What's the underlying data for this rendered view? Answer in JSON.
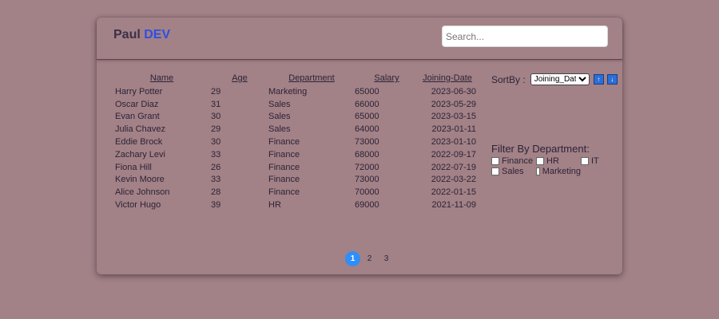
{
  "header": {
    "brand_first": "Paul",
    "brand_second": "DEV",
    "search_placeholder": "Search..."
  },
  "table": {
    "columns": [
      "Name",
      "Age",
      "Department",
      "Salary",
      "Joining-Date"
    ],
    "rows": [
      [
        "Harry Potter",
        "29",
        "Marketing",
        "65000",
        "2023-06-30"
      ],
      [
        "Oscar Diaz",
        "31",
        "Sales",
        "66000",
        "2023-05-29"
      ],
      [
        "Evan Grant",
        "30",
        "Sales",
        "65000",
        "2023-03-15"
      ],
      [
        "Julia Chavez",
        "29",
        "Sales",
        "64000",
        "2023-01-11"
      ],
      [
        "Eddie Brock",
        "30",
        "Finance",
        "73000",
        "2023-01-10"
      ],
      [
        "Zachary Levi",
        "33",
        "Finance",
        "68000",
        "2022-09-17"
      ],
      [
        "Fiona Hill",
        "26",
        "Finance",
        "72000",
        "2022-07-19"
      ],
      [
        "Kevin Moore",
        "33",
        "Finance",
        "73000",
        "2022-03-22"
      ],
      [
        "Alice Johnson",
        "28",
        "Finance",
        "70000",
        "2022-01-15"
      ],
      [
        "Victor Hugo",
        "39",
        "HR",
        "69000",
        "2021-11-09"
      ]
    ]
  },
  "sort": {
    "label": "SortBy :",
    "selected": "Joining_Date",
    "asc_icon": "↑",
    "desc_icon": "↓"
  },
  "filter": {
    "title": "Filter By Department:",
    "options": [
      "Finance",
      "HR",
      "IT",
      "Sales",
      "Marketing"
    ]
  },
  "pagination": {
    "pages": [
      "1",
      "2",
      "3"
    ],
    "active": "1"
  },
  "colors": {
    "background": "#a28187",
    "brand_accent": "#2f4fe0",
    "active_page": "#2f8ef8",
    "sort_button": "#2a6fd8"
  }
}
